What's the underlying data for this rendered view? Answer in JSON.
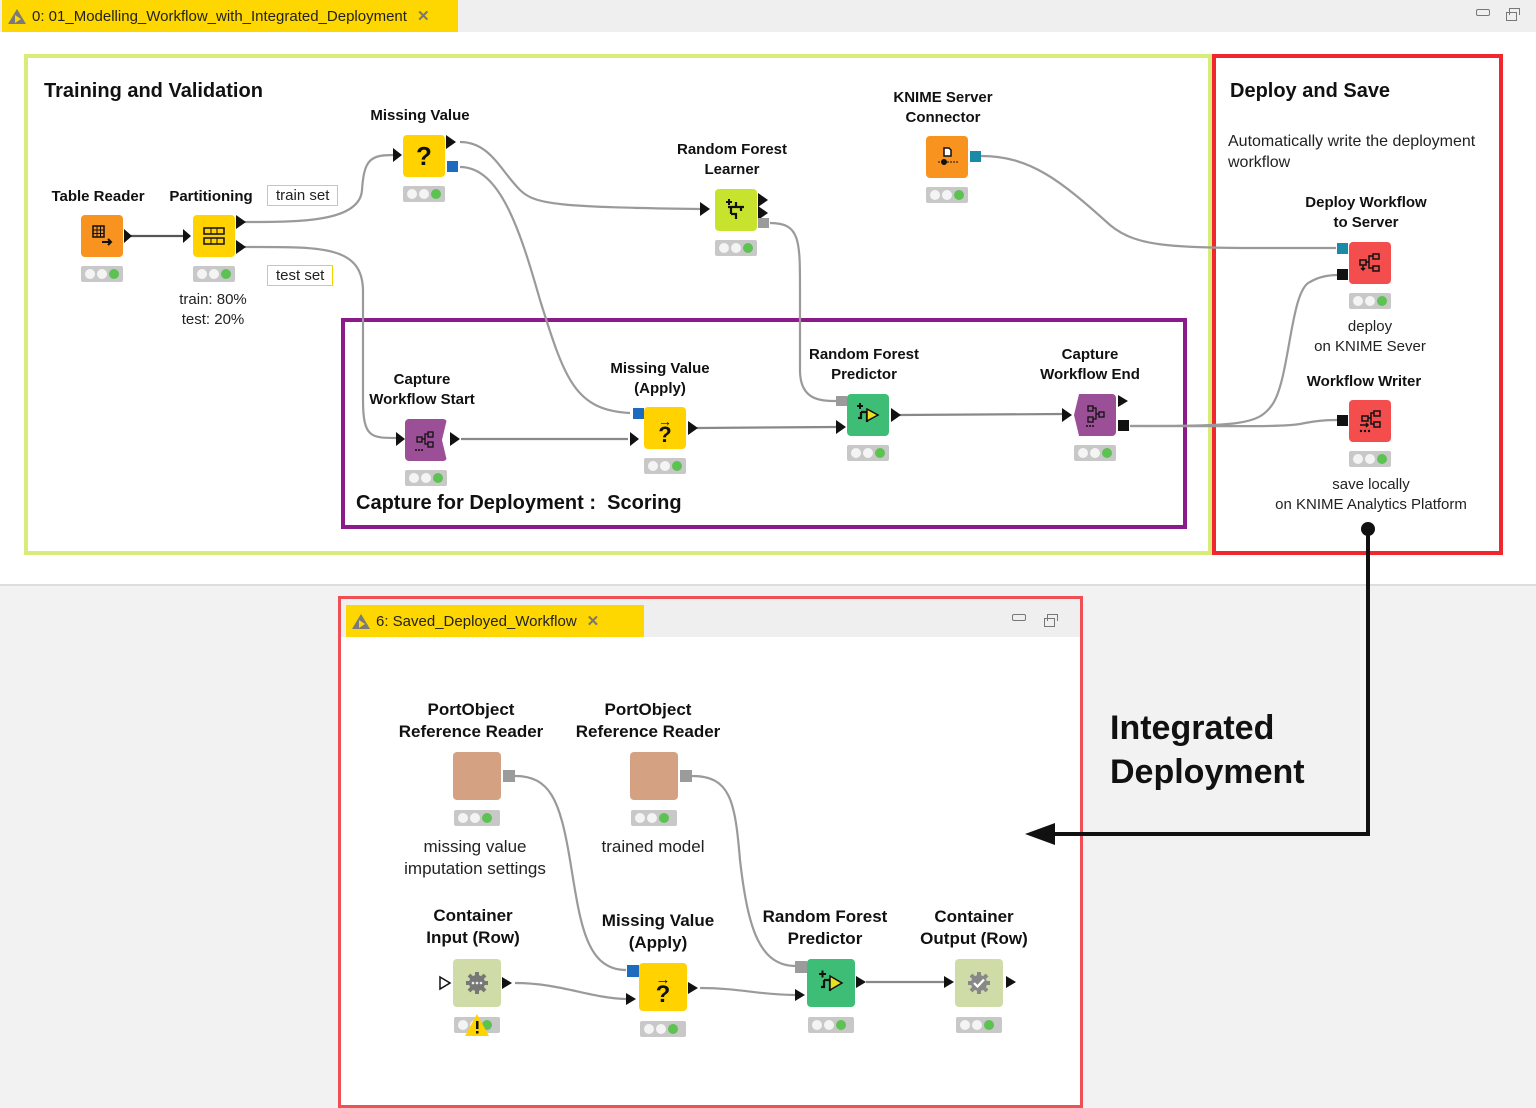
{
  "colors": {
    "tab_yellow": "#ffd700",
    "training_box": "#d8ec7a",
    "deploy_box": "#f0282d",
    "capture_box": "#8b1a8b",
    "saved_box": "#f05055"
  },
  "top_window": {
    "tab_title": "0: 01_Modelling_Workflow_with_Integrated_Deployment",
    "tab_icon": "warning-triangle-icon",
    "close_icon": "close-icon",
    "minimize_icon": "minimize-icon",
    "restore_icon": "restore-icon"
  },
  "annotations": {
    "training": {
      "title": "Training and Validation"
    },
    "deploy": {
      "title": "Deploy and Save",
      "description": "Automatically write the deployment\nworkflow"
    },
    "capture": {
      "title": "Capture for Deployment :  Scoring"
    }
  },
  "notes": {
    "train_set": "train set",
    "test_set": "test set"
  },
  "nodes": {
    "table_reader": {
      "label": "Table Reader",
      "icon": "table-reader-icon",
      "status": "executed"
    },
    "partitioning": {
      "label": "Partitioning",
      "icon": "partitioning-icon",
      "sub": "train: 80%\ntest: 20%",
      "status": "executed"
    },
    "missing_value": {
      "label": "Missing Value",
      "icon": "question-mark-icon",
      "glyph": "?",
      "status": "executed"
    },
    "rf_learner": {
      "label": "Random Forest\nLearner",
      "icon": "random-forest-learner-icon",
      "status": "executed"
    },
    "server_connector": {
      "label": "KNIME Server\nConnector",
      "icon": "server-connector-icon",
      "status": "executed"
    },
    "deploy_workflow": {
      "label": "Deploy Workflow\nto Server",
      "icon": "workflow-deploy-icon",
      "sub": "deploy\non KNIME Sever",
      "status": "executed"
    },
    "workflow_writer": {
      "label": "Workflow Writer",
      "icon": "workflow-writer-icon",
      "sub": "save locally\non KNIME Analytics Platform",
      "status": "executed"
    },
    "capture_start": {
      "label": "Capture\nWorkflow Start",
      "icon": "capture-start-icon",
      "status": "executed"
    },
    "mv_apply": {
      "label": "Missing Value\n(Apply)",
      "icon": "missing-value-apply-icon",
      "glyph": "?",
      "status": "executed"
    },
    "rf_predictor": {
      "label": "Random Forest\nPredictor",
      "icon": "random-forest-predictor-icon",
      "status": "executed"
    },
    "capture_end": {
      "label": "Capture\nWorkflow End",
      "icon": "capture-end-icon",
      "status": "executed"
    }
  },
  "integrated_label": "Integrated\nDeployment",
  "bottom_window": {
    "tab_title": "6: Saved_Deployed_Workflow",
    "tab_icon": "warning-triangle-icon",
    "close_icon": "close-icon",
    "nodes": {
      "por_reader_1": {
        "label": "PortObject\nReference Reader",
        "sub": "missing value\nimputation settings",
        "status": "executed"
      },
      "por_reader_2": {
        "label": "PortObject\nReference Reader",
        "sub": "trained model",
        "status": "executed"
      },
      "container_input": {
        "label": "Container\nInput (Row)",
        "icon": "gear-icon",
        "status": "warning"
      },
      "mv_apply": {
        "label": "Missing Value\n(Apply)",
        "glyph": "?",
        "status": "executed"
      },
      "rf_predictor": {
        "label": "Random Forest\nPredictor",
        "status": "executed"
      },
      "container_output": {
        "label": "Container\nOutput (Row)",
        "icon": "gear-check-icon",
        "status": "executed"
      }
    }
  }
}
